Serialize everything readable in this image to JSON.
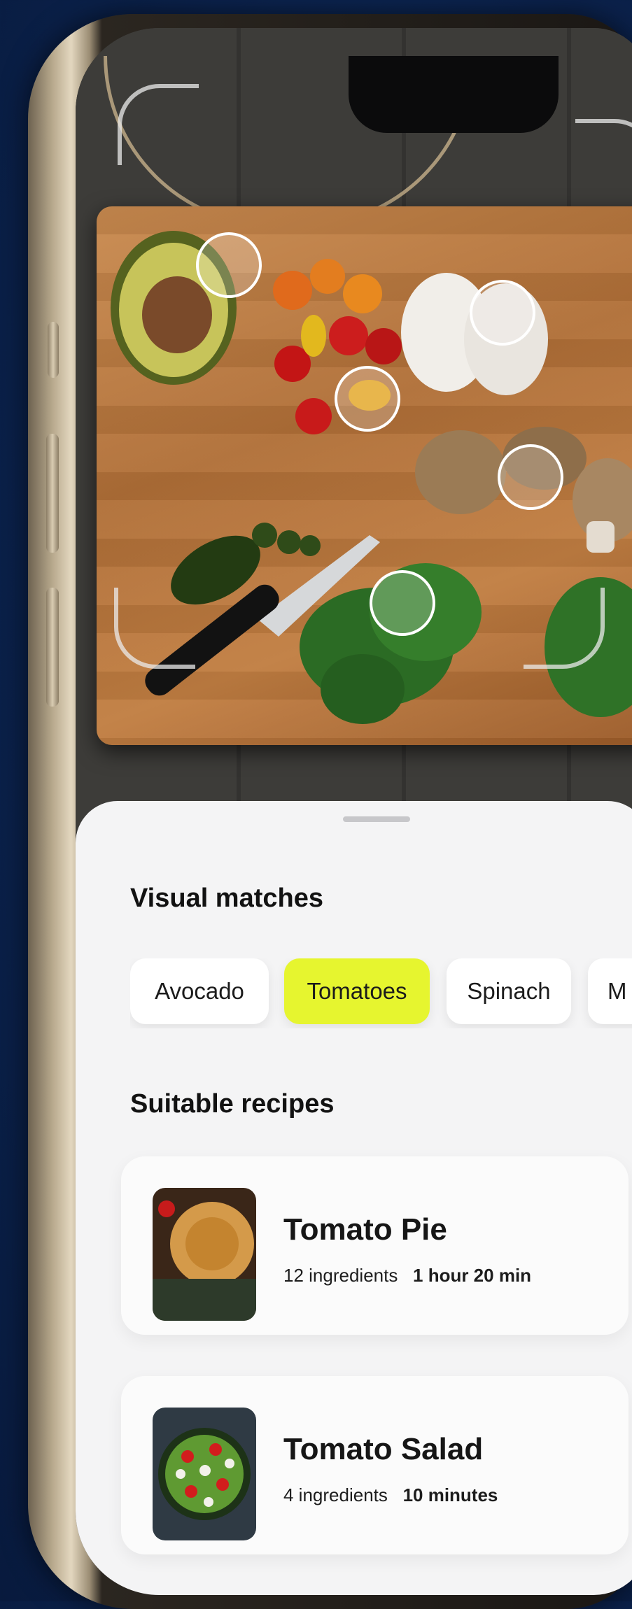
{
  "theme": {
    "accent": "#e6f52f",
    "background": "#0c2552",
    "sheet": "#f4f4f5"
  },
  "scan": {
    "detected_items": [
      "avocado",
      "tomatoes",
      "eggs",
      "mushrooms",
      "spinach"
    ]
  },
  "sheet": {
    "visual_matches_title": "Visual matches",
    "chips": [
      {
        "label": "Avocado",
        "selected": false
      },
      {
        "label": "Tomatoes",
        "selected": true
      },
      {
        "label": "Spinach",
        "selected": false
      },
      {
        "label": "M",
        "selected": false
      }
    ],
    "recipes_title": "Suitable recipes",
    "recipes": [
      {
        "name": "Tomato Pie",
        "ingredients": "12 ingredients",
        "time": "1 hour 20 min"
      },
      {
        "name": "Tomato Salad",
        "ingredients": "4 ingredients",
        "time": "10 minutes"
      }
    ]
  }
}
